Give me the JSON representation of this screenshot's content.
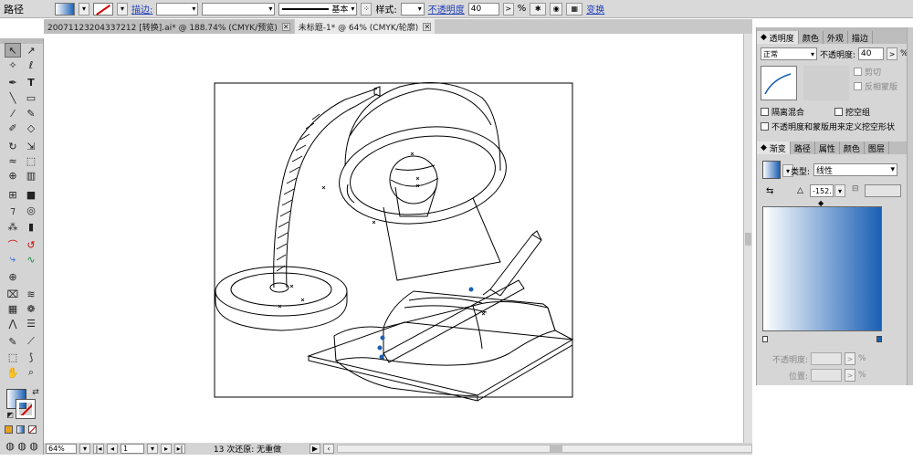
{
  "control_bar": {
    "path_label": "路径",
    "stroke_label": "描边:",
    "line_style": "基本",
    "style_label": "样式:",
    "opacity_label": "不透明度",
    "opacity_value": "40",
    "opacity_unit": "%",
    "transform_label": "变换"
  },
  "doc_tabs": [
    {
      "label": "20071123204337212 [转换].ai* @ 188.74% (CMYK/预览)"
    },
    {
      "label": "未标题-1* @ 64% (CMYK/轮廓)"
    }
  ],
  "status_bar": {
    "zoom": "64%",
    "artboard": "1",
    "message": "13 次还原: 无重做"
  },
  "transparency_panel": {
    "tabs": [
      "透明度",
      "颜色",
      "外观",
      "描边"
    ],
    "blend_mode": "正常",
    "opacity_label": "不透明度:",
    "opacity_value": "40",
    "opacity_unit": "%",
    "clip_label": "剪切",
    "invert_mask_label": "反相蒙版",
    "isolate_blend_label": "隔离混合",
    "knockout_group_label": "挖空组",
    "opacity_mask_label": "不透明度和蒙版用来定义挖空形状"
  },
  "gradient_panel": {
    "tabs": [
      "渐变",
      "路径",
      "属性",
      "颜色",
      "图层"
    ],
    "type_label": "类型:",
    "type_value": "线性",
    "angle_value": "-152.",
    "opacity_label": "不透明度:",
    "location_label": "位置:",
    "percent_unit": "%",
    "colors": {
      "start": "#ffffff",
      "end": "#1a5fb4"
    }
  }
}
